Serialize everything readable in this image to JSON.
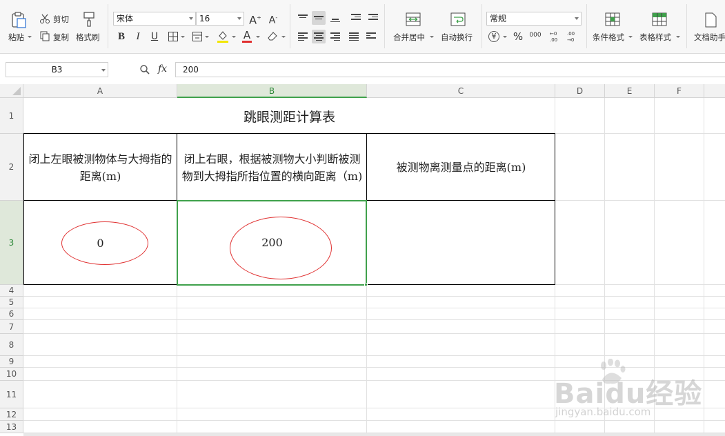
{
  "ribbon": {
    "paste_label": "粘贴",
    "cut_label": "剪切",
    "copy_label": "复制",
    "format_painter_label": "格式刷",
    "font_name": "宋体",
    "font_size": "16",
    "grow_font": "A",
    "shrink_font": "A",
    "bold": "B",
    "italic": "I",
    "underline": "U",
    "font_color_letter": "A",
    "merge_center_label": "合并居中",
    "wrap_text_label": "自动换行",
    "number_format": "常规",
    "currency_symbol": "¥",
    "percent_symbol": "%",
    "thousands_symbol": "000",
    "conditional_format_label": "条件格式",
    "table_style_label": "表格样式",
    "doc_helper_label": "文档助手",
    "accent_color": "#3fa14b"
  },
  "formula_bar": {
    "name_box": "B3",
    "zoom_icon": "magnifier-icon",
    "fx_label": "fx",
    "value": "200"
  },
  "columns": [
    "A",
    "B",
    "C",
    "D",
    "E",
    "F"
  ],
  "rows": [
    "1",
    "2",
    "3",
    "4",
    "5",
    "6",
    "7",
    "8",
    "9",
    "10",
    "11",
    "12",
    "13"
  ],
  "selected_cell": "B3",
  "sheet": {
    "title": "跳眼测距计算表",
    "header_a": "闭上左眼被测物体与大拇指的距离(m)",
    "header_b": "闭上右眼，根据被测物大小判断被测物到大拇指所指位置的横向距离（m)",
    "header_c": "被测物离测量点的距离(m)",
    "value_a3": "0",
    "value_b3": "200",
    "value_c3": ""
  },
  "watermark": {
    "brand": "Baidu经验",
    "url": "jingyan.baidu.com"
  }
}
